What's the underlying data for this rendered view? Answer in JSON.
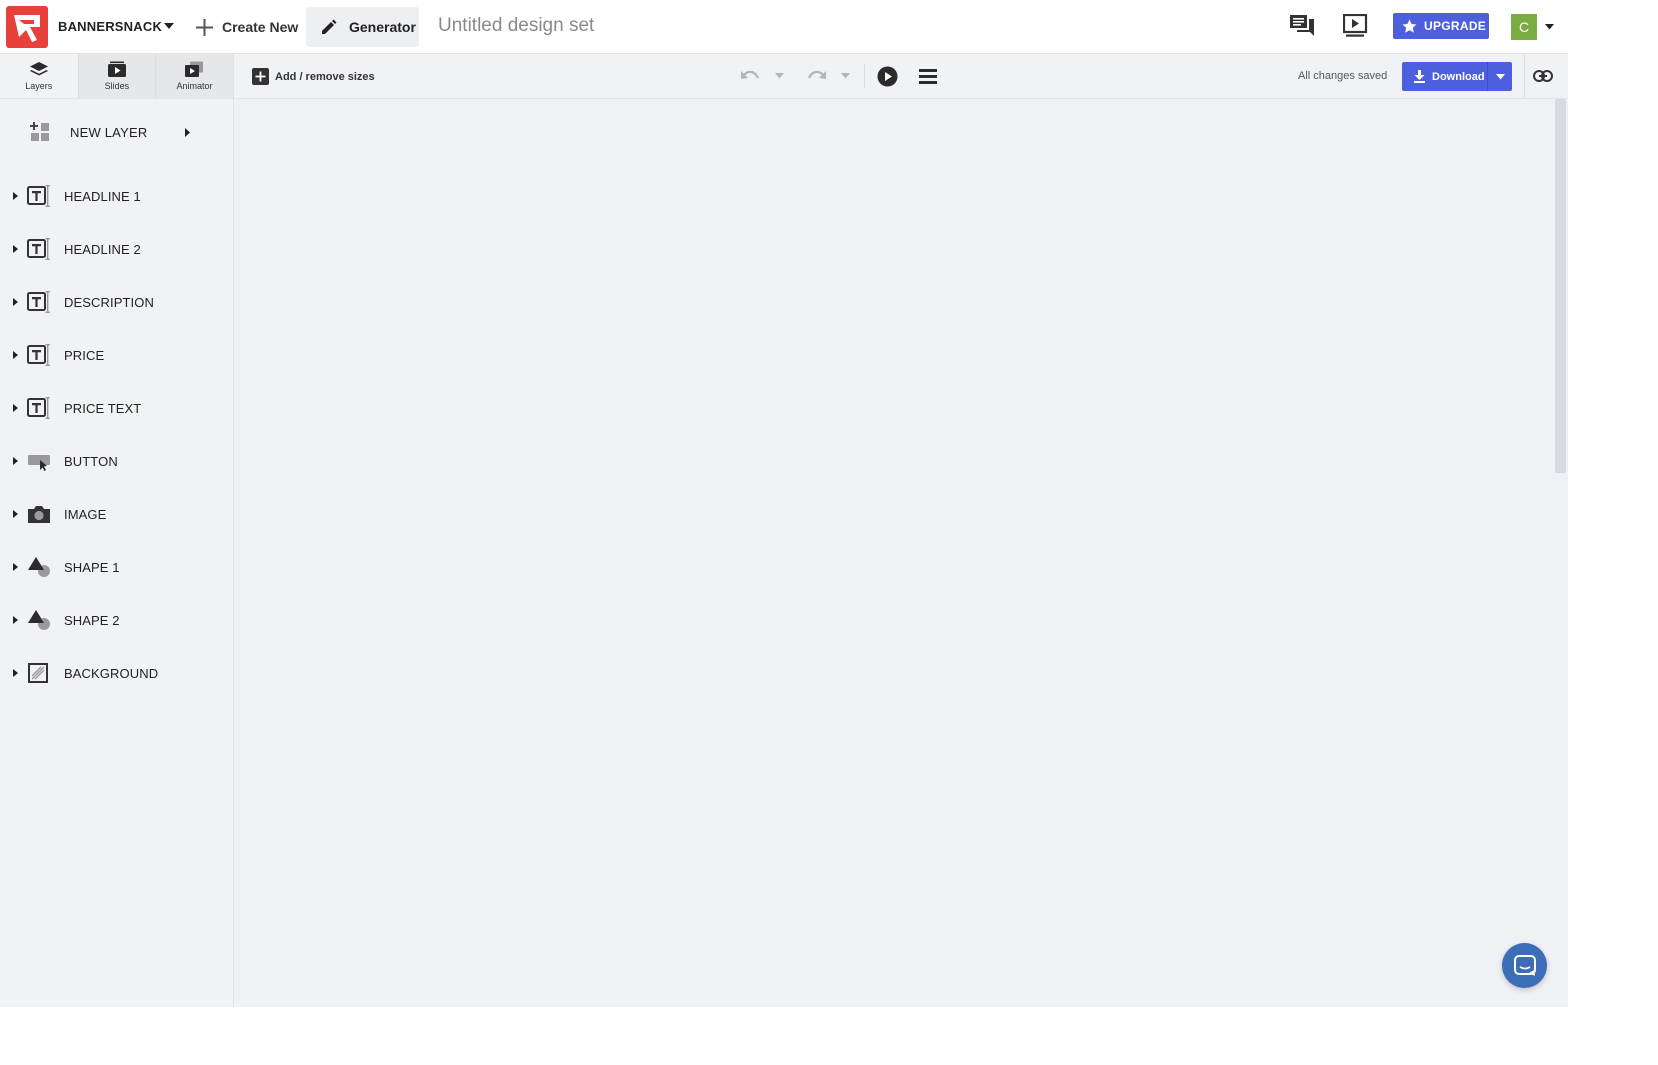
{
  "header": {
    "brand": "BANNERSNACK",
    "create_new": "Create New",
    "generator": "Generator",
    "doc_title": "Untitled design set",
    "upgrade": "UPGRADE",
    "avatar_letter": "C"
  },
  "sidebar": {
    "tabs": [
      {
        "label": "Layers"
      },
      {
        "label": "Slides"
      },
      {
        "label": "Animator"
      }
    ],
    "new_layer": "NEW LAYER",
    "layers": [
      {
        "label": "HEADLINE 1",
        "icon": "text-layer-icon"
      },
      {
        "label": "HEADLINE 2",
        "icon": "text-layer-icon"
      },
      {
        "label": "DESCRIPTION",
        "icon": "text-layer-icon"
      },
      {
        "label": "PRICE",
        "icon": "text-layer-icon"
      },
      {
        "label": "PRICE TEXT",
        "icon": "text-layer-icon"
      },
      {
        "label": "BUTTON",
        "icon": "button-layer-icon"
      },
      {
        "label": "IMAGE",
        "icon": "camera-icon"
      },
      {
        "label": "SHAPE 1",
        "icon": "shape-icon"
      },
      {
        "label": "SHAPE 2",
        "icon": "shape-icon"
      },
      {
        "label": "BACKGROUND",
        "icon": "background-icon"
      }
    ]
  },
  "toolbar": {
    "add_sizes": "Add / remove sizes",
    "status": "All changes saved",
    "download": "Download"
  },
  "colors": {
    "accent": "#4d5fdc",
    "brand_red": "#e8403a",
    "avatar_green": "#7bab43",
    "chat_blue": "#3e6db8"
  }
}
